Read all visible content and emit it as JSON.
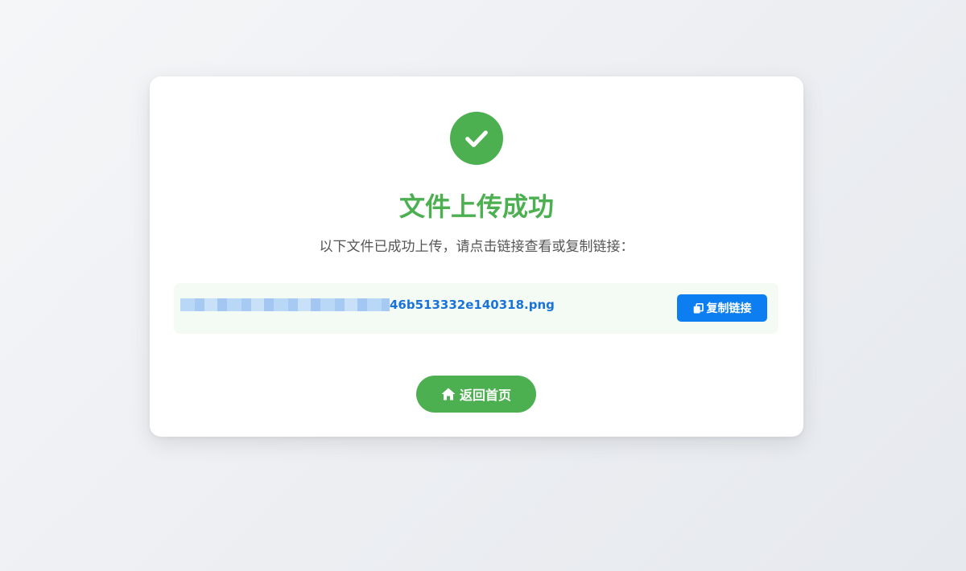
{
  "colors": {
    "success": "#4caf50",
    "primary": "#0d7ef2",
    "link": "#1a73d9",
    "subtitle": "#555555"
  },
  "status": {
    "icon": "check-circle-icon",
    "title": "文件上传成功",
    "message": "以下文件已成功上传，请点击链接查看或复制链接："
  },
  "file": {
    "name_visible": "46b513332e140318.png"
  },
  "actions": {
    "copy_label": "复制链接",
    "copy_icon": "copy-icon",
    "home_label": "返回首页",
    "home_icon": "home-icon"
  }
}
